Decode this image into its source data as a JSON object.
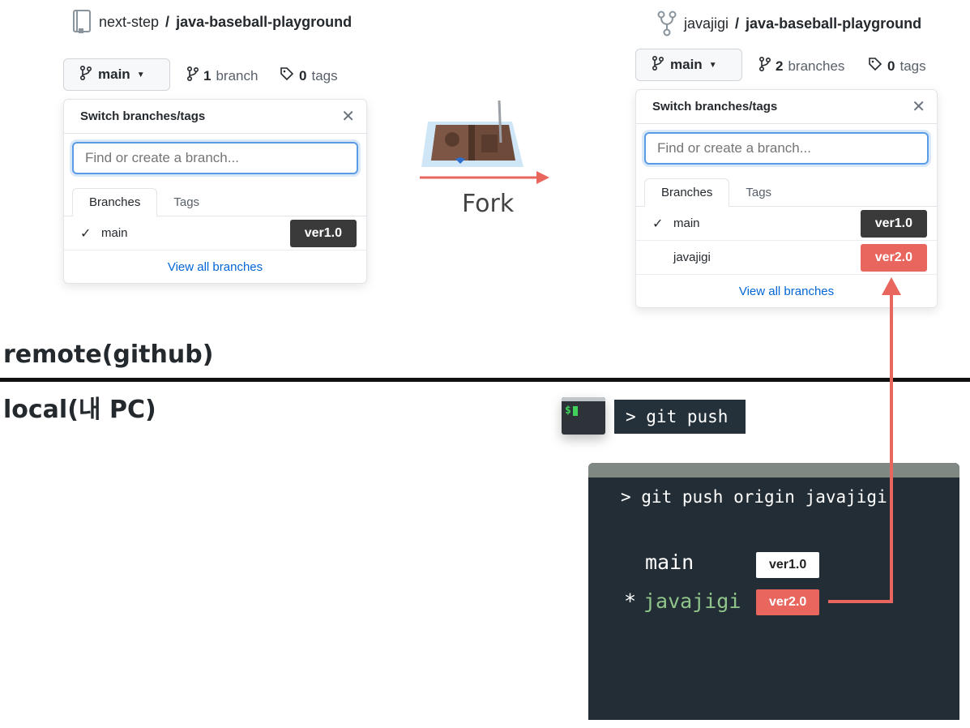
{
  "left_repo": {
    "owner": "next-step",
    "separator": "/",
    "name": "java-baseball-playground",
    "branch_button": "main",
    "branch_count": "1",
    "branch_word": "branch",
    "tag_count": "0",
    "tag_word": "tags",
    "dropdown": {
      "title": "Switch branches/tags",
      "placeholder": "Find or create a branch...",
      "tabs": [
        "Branches",
        "Tags"
      ],
      "rows": [
        {
          "name": "main",
          "checked": true,
          "tag": "ver1.0"
        }
      ],
      "footer": "View all branches"
    }
  },
  "right_repo": {
    "owner": "javajigi",
    "separator": "/",
    "name": "java-baseball-playground",
    "branch_button": "main",
    "branch_count": "2",
    "branch_word": "branches",
    "tag_count": "0",
    "tag_word": "tags",
    "dropdown": {
      "title": "Switch branches/tags",
      "placeholder": "Find or create a branch...",
      "tabs": [
        "Branches",
        "Tags"
      ],
      "rows": [
        {
          "name": "main",
          "checked": true,
          "tag": "ver1.0"
        },
        {
          "name": "javajigi",
          "checked": false,
          "tag": "ver2.0"
        }
      ],
      "footer": "View all branches"
    }
  },
  "fork": {
    "label": "Fork"
  },
  "sections": {
    "remote": "remote(github)",
    "local": "local(내 PC)"
  },
  "terminal": {
    "icon_text": "$",
    "command": "> git push",
    "window_command": "> git push origin javajigi",
    "branches": [
      {
        "name": "main",
        "current": false,
        "tag": "ver1.0"
      },
      {
        "name": "javajigi",
        "current": true,
        "marker": "*",
        "tag": "ver2.0"
      }
    ]
  },
  "colors": {
    "accent_red": "#e8665d",
    "tag_dark": "#3a3a3a",
    "terminal_bg": "#222d35",
    "link_blue": "#0366d6"
  }
}
